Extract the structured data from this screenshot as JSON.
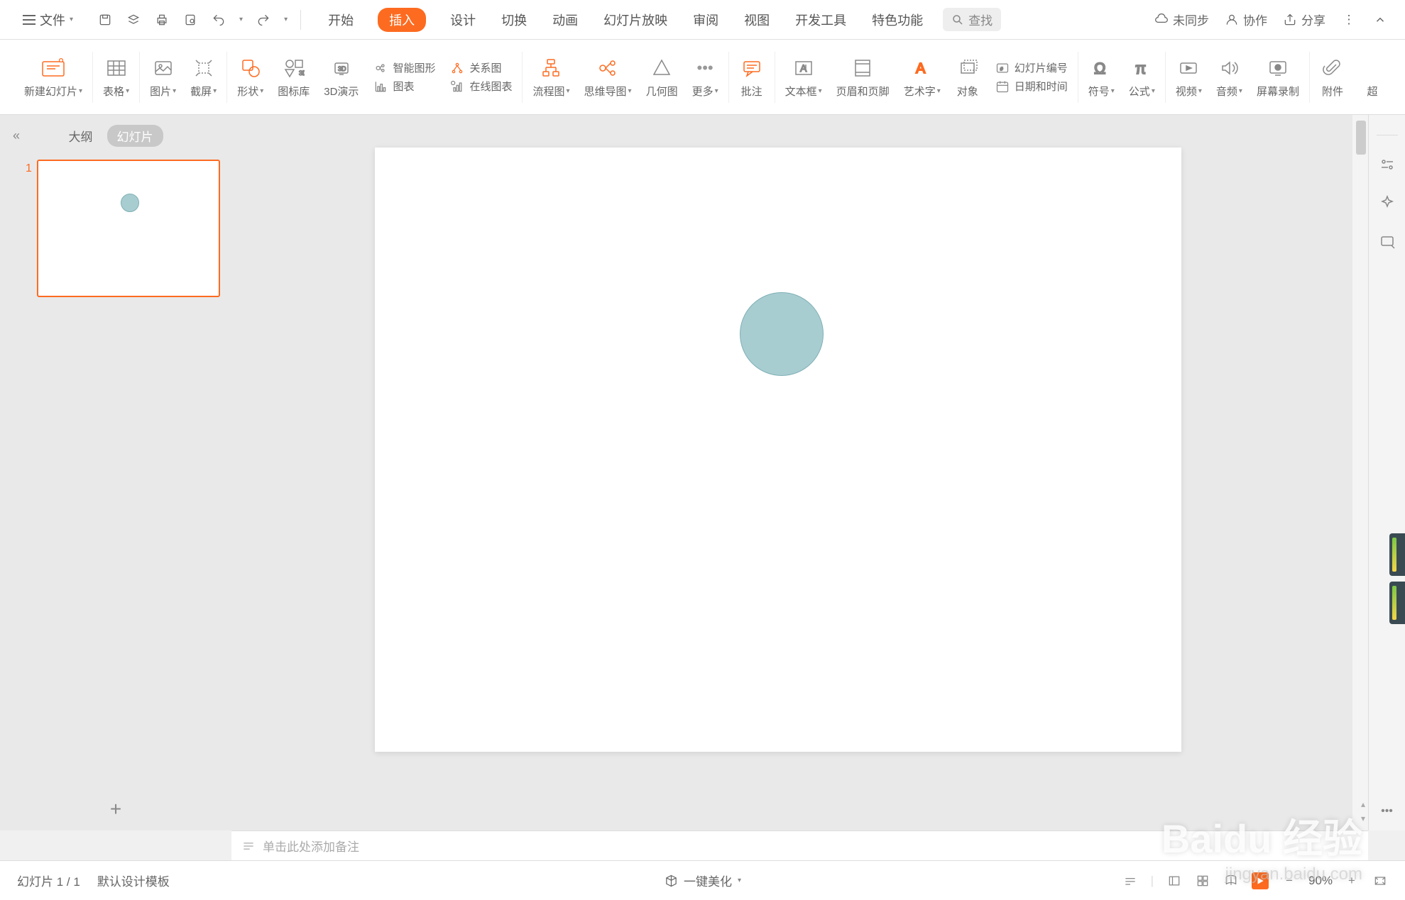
{
  "topbar": {
    "file": "文件",
    "tabs": [
      "开始",
      "插入",
      "设计",
      "切换",
      "动画",
      "幻灯片放映",
      "审阅",
      "视图",
      "开发工具",
      "特色功能"
    ],
    "active_tab_index": 1,
    "search_placeholder": "查找",
    "right": {
      "unsync": "未同步",
      "collab": "协作",
      "share": "分享"
    }
  },
  "ribbon": {
    "new_slide": "新建幻灯片",
    "table": "表格",
    "image": "图片",
    "screenshot": "截屏",
    "shape": "形状",
    "icon_lib": "图标库",
    "presentation_3d": "3D演示",
    "smart_graphic": "智能图形",
    "chart": "图表",
    "relation": "关系图",
    "online_chart": "在线图表",
    "flowchart": "流程图",
    "mindmap": "思维导图",
    "geometry": "几何图",
    "more": "更多",
    "comment": "批注",
    "textbox": "文本框",
    "header_footer": "页眉和页脚",
    "wordart": "艺术字",
    "object": "对象",
    "slide_number": "幻灯片编号",
    "date_time": "日期和时间",
    "symbol": "符号",
    "equation": "公式",
    "video": "视频",
    "audio": "音频",
    "screen_record": "屏幕录制",
    "attachment": "附件",
    "overflow": "超"
  },
  "side": {
    "outline": "大纲",
    "slides": "幻灯片",
    "thumb_number": "1"
  },
  "notes_placeholder": "单击此处添加备注",
  "status": {
    "slide_indicator": "幻灯片 1 / 1",
    "template": "默认设计模板",
    "beautify": "一键美化",
    "zoom": "90%"
  },
  "watermark": {
    "main": "Baidu 经验",
    "sub": "jingyan.baidu.com"
  }
}
